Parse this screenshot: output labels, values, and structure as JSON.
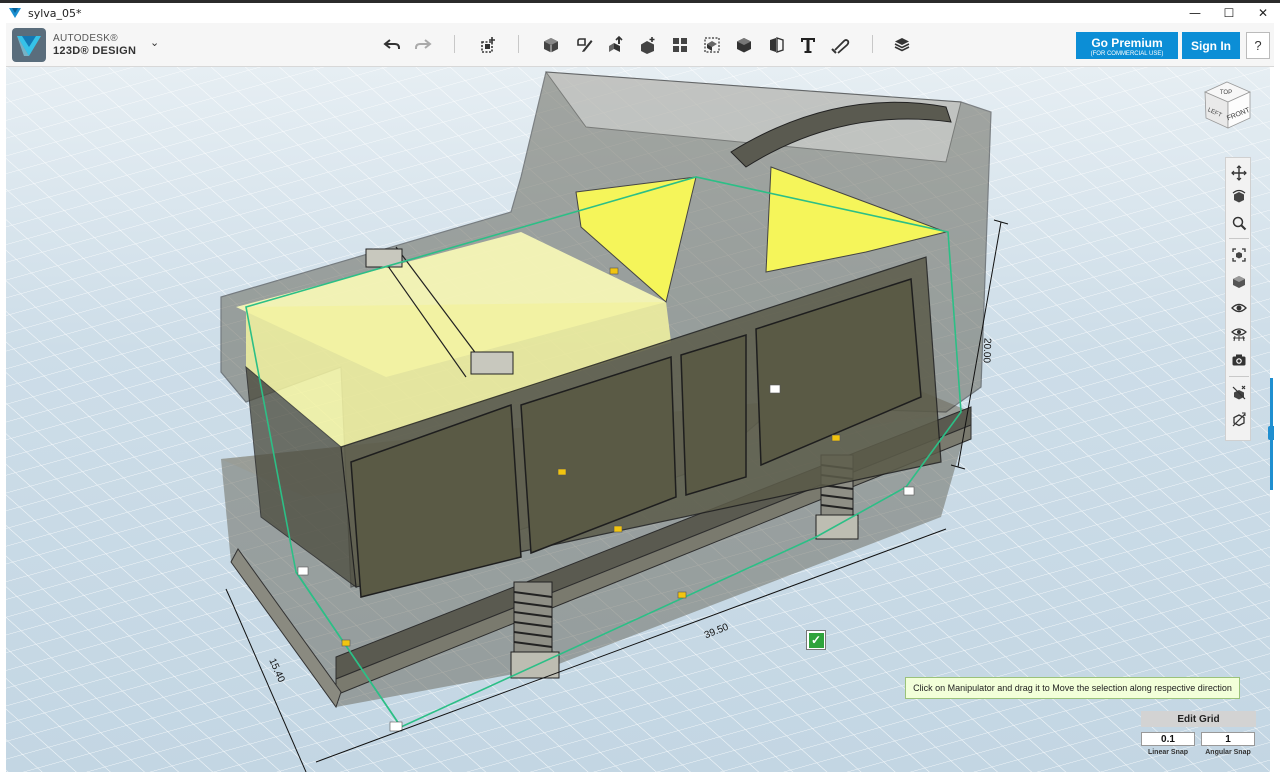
{
  "window": {
    "title": "sylva_05*",
    "minimize": "—",
    "maximize": "☐",
    "close": "✕"
  },
  "brand": {
    "line1": "AUTODESK®",
    "line2": "123D® DESIGN",
    "caret": "⌄"
  },
  "toolbar": {
    "icons": [
      "undo-icon",
      "redo-icon",
      "transform-icon",
      "primitives-icon",
      "sketch-icon",
      "construct-icon",
      "modify-icon",
      "pattern-icon",
      "group-icon",
      "combine-icon",
      "measure-icon",
      "text-icon",
      "snap-icon",
      "material-icon"
    ]
  },
  "account": {
    "premium_label": "Go Premium",
    "premium_sub": "(FOR COMMERCIAL USE)",
    "signin_label": "Sign In",
    "help_label": "?"
  },
  "viewcube": {
    "top": "TOP",
    "left": "LEFT",
    "front": "FRONT"
  },
  "navbar": {
    "icons": [
      "pan-icon",
      "orbit-icon",
      "zoom-icon",
      "fit-icon",
      "view-mode-icon",
      "visibility-icon",
      "grid-visibility-icon",
      "camera-icon",
      "material-toggle-icon",
      "outline-toggle-icon"
    ]
  },
  "dimensions": {
    "width": "39.50",
    "depth": "15.40",
    "height": "20.00"
  },
  "hint": {
    "text": "Click on Manipulator and drag it to Move the selection along respective direction"
  },
  "confirm": {
    "glyph": "✓"
  },
  "edit_grid": {
    "title": "Edit Grid",
    "linear_value": "0.1",
    "angular_value": "1",
    "linear_label": "Linear Snap",
    "angular_label": "Angular Snap"
  },
  "colors": {
    "accent": "#0c8ed6",
    "selection": "#2cbf86",
    "highlight_yellow": "#f2f25a",
    "grid_bg": "#c9dbe6",
    "hint_bg": "#f2ffd9",
    "confirm_green": "#2fa33b"
  }
}
